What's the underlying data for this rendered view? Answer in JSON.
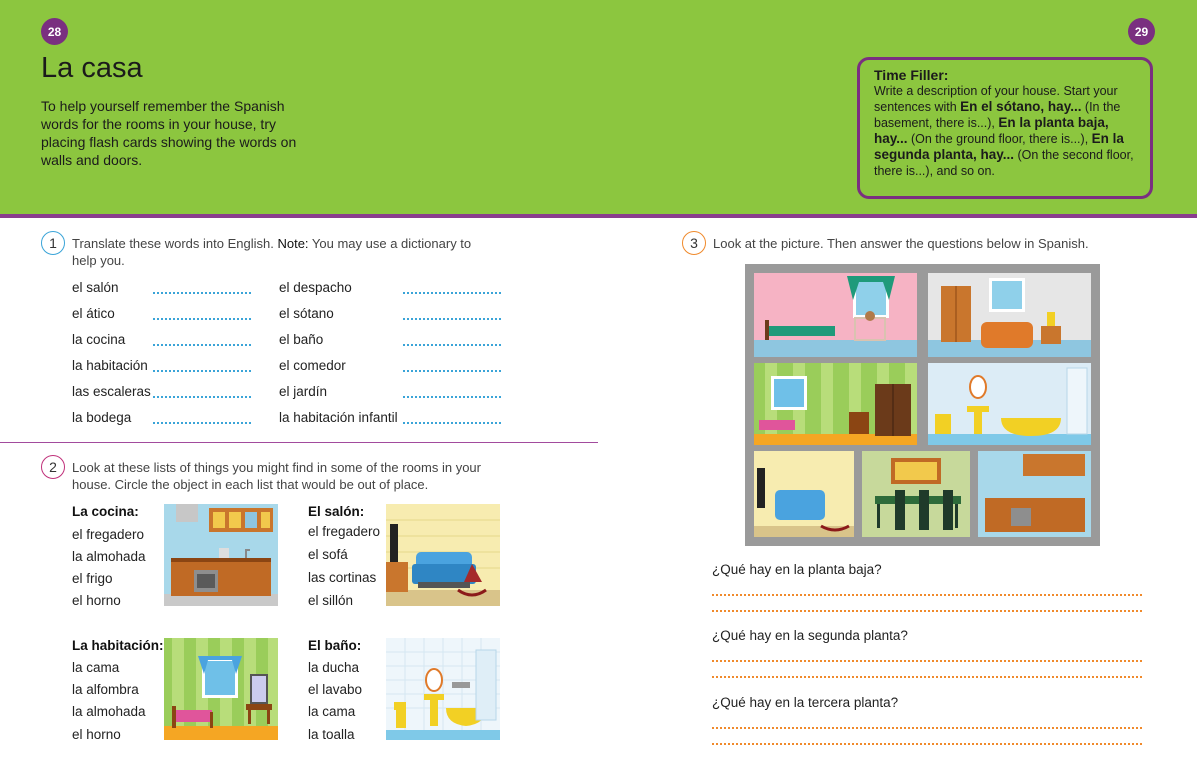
{
  "page_left": "28",
  "page_right": "29",
  "title": "La casa",
  "intro": "To help yourself remember the Spanish words for the rooms in your house, try placing flash cards showing the words on walls and doors.",
  "filler": {
    "title": "Time Filler:",
    "t1": "Write a description of your house. Start your sentences with ",
    "b1": "En el sótano, hay...",
    "t2": " (In the basement, there is...), ",
    "b2": "En la planta baja, hay...",
    "t3": " (On the ground floor, there is...), ",
    "b3": "En la segunda planta, hay...",
    "t4": " (On the second floor, there is...), and so on."
  },
  "ex1": {
    "num": "1",
    "instr": "Translate these words into English. ",
    "note": "Note:",
    "instr2": " You may use a dictionary to help you.",
    "col1": [
      "el salón",
      "el ático",
      "la cocina",
      "la habitación",
      "las escaleras",
      "la bodega"
    ],
    "col2": [
      "el despacho",
      "el sótano",
      "el baño",
      "el comedor",
      "el jardín",
      "la habitación infantil"
    ]
  },
  "ex2": {
    "num": "2",
    "instr": "Look at these lists of things you might find in some of the rooms in your house. Circle the object in each list that would be out of place.",
    "lists": [
      {
        "head": "La cocina:",
        "items": [
          "el fregadero",
          "la almohada",
          "el frigo",
          "el horno"
        ]
      },
      {
        "head": "El salón:",
        "items": [
          "el fregadero",
          "el sofá",
          "las cortinas",
          "el sillón"
        ]
      },
      {
        "head": "La habitación:",
        "items": [
          "la cama",
          "la alfombra",
          "la almohada",
          "el horno"
        ]
      },
      {
        "head": "El baño:",
        "items": [
          "la ducha",
          "el lavabo",
          "la cama",
          "la toalla"
        ]
      }
    ]
  },
  "ex3": {
    "num": "3",
    "instr": "Look at the picture. Then answer the questions below in Spanish.",
    "questions": [
      "¿Qué hay en la planta baja?",
      "¿Qué hay en la segunda planta?",
      "¿Qué hay en la tercera planta?"
    ]
  },
  "colors": {
    "header_green": "#8cc63f",
    "accent_purple": "#7a2f80",
    "blue": "#3aa4d8",
    "orange": "#f08a2c"
  }
}
